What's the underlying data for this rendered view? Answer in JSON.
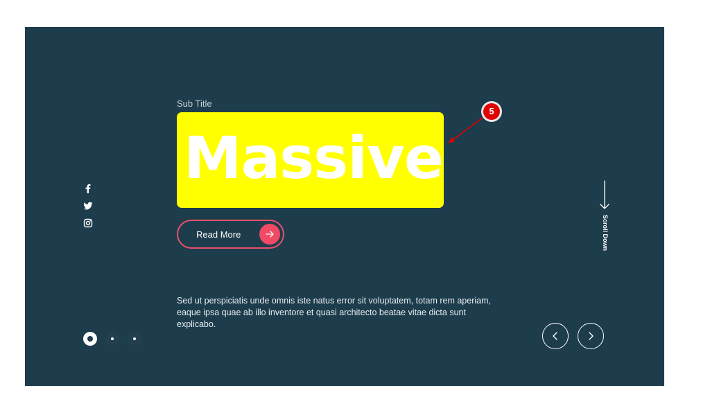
{
  "hero": {
    "subtitle": "Sub Title",
    "title": "Massive",
    "highlight_color": "#ffff00",
    "background_color": "#1d3c4c",
    "description": "Sed ut perspiciatis unde omnis iste natus error sit voluptatem, totam rem aperiam, eaque ipsa quae ab illo inventore et quasi architecto beatae vitae dicta sunt explicabo.",
    "button": {
      "label": "Read More",
      "icon": "arrow-right-icon",
      "accent_color": "#f04a64"
    }
  },
  "social": {
    "items": [
      {
        "icon": "facebook-icon"
      },
      {
        "icon": "twitter-icon"
      },
      {
        "icon": "instagram-icon"
      }
    ]
  },
  "scroll": {
    "label": "Scroll Down",
    "icon": "arrow-down-icon"
  },
  "slider": {
    "total_slides": 3,
    "active_index": 0,
    "prev_icon": "chevron-left-icon",
    "next_icon": "chevron-right-icon"
  },
  "annotation": {
    "number": "5",
    "color": "#e00000"
  }
}
